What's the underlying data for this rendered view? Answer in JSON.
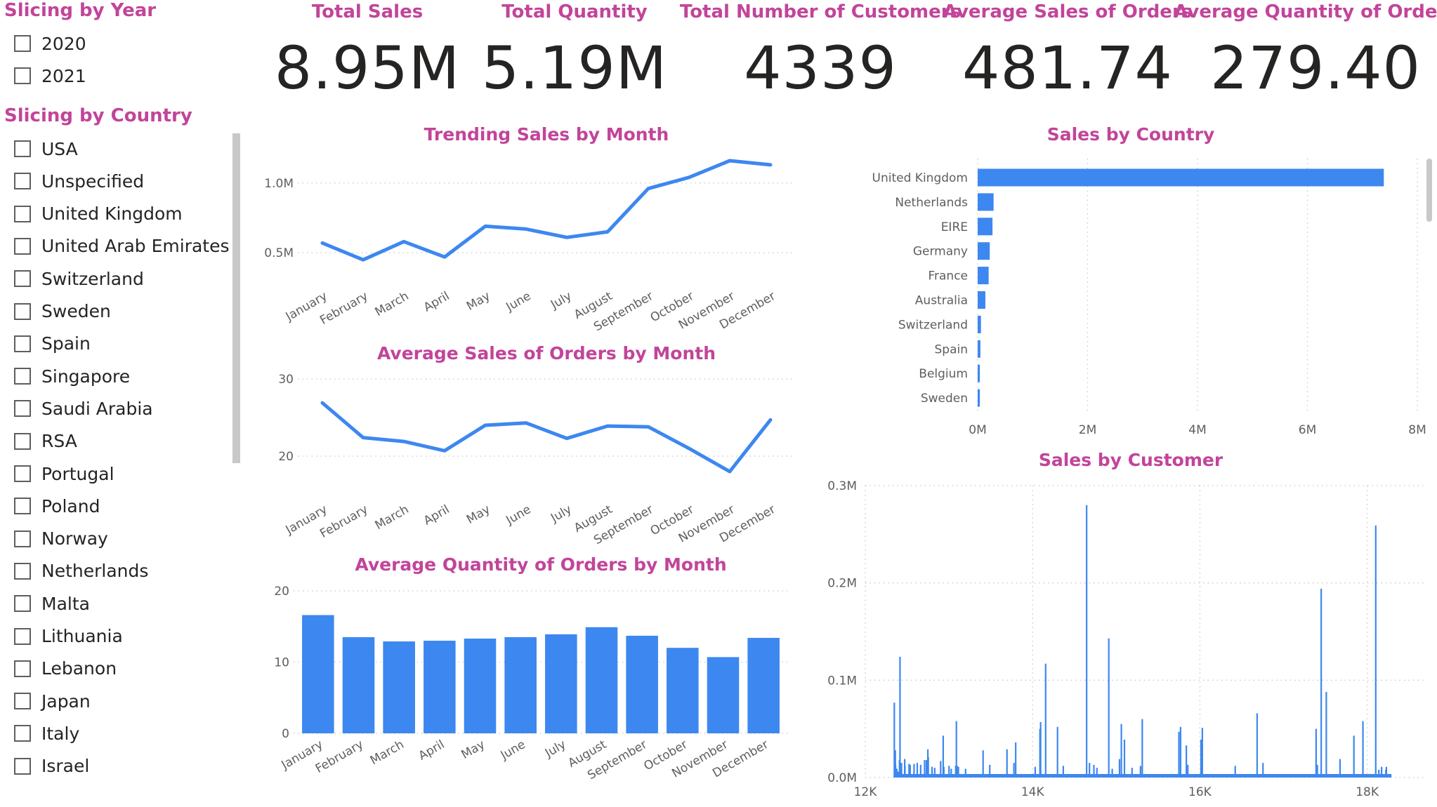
{
  "year_slicer": {
    "title": "Slicing by Year",
    "items": [
      "2020",
      "2021"
    ]
  },
  "country_slicer": {
    "title": "Slicing by Country",
    "items": [
      "USA",
      "Unspecified",
      "United Kingdom",
      "United Arab Emirates",
      "Switzerland",
      "Sweden",
      "Spain",
      "Singapore",
      "Saudi Arabia",
      "RSA",
      "Portugal",
      "Poland",
      "Norway",
      "Netherlands",
      "Malta",
      "Lithuania",
      "Lebanon",
      "Japan",
      "Italy",
      "Israel"
    ]
  },
  "kpis": [
    {
      "label": "Total Sales",
      "value": "8.95M"
    },
    {
      "label": "Total Quantity",
      "value": "5.19M"
    },
    {
      "label": "Total Number of Customers",
      "value": "4339"
    },
    {
      "label": "Average Sales of Orders",
      "value": "481.74"
    },
    {
      "label": "Average Quantity of Orders",
      "value": "279.40"
    }
  ],
  "colors": {
    "accent": "#c2449a",
    "series": "#3d87f0",
    "text": "#252423"
  },
  "chart_data": [
    {
      "id": "trend",
      "type": "line",
      "title": "Trending Sales by Month",
      "categories": [
        "January",
        "February",
        "March",
        "April",
        "May",
        "June",
        "July",
        "August",
        "September",
        "October",
        "November",
        "December"
      ],
      "values": [
        0.57,
        0.45,
        0.58,
        0.47,
        0.69,
        0.67,
        0.61,
        0.65,
        0.96,
        1.04,
        1.16,
        1.13
      ],
      "ylim": [
        0.3,
        1.2
      ],
      "yticks": [
        0.5,
        1.0
      ],
      "ytick_labels": [
        "0.5M",
        "1.0M"
      ],
      "grid": true
    },
    {
      "id": "avgsales",
      "type": "line",
      "title": "Average Sales of Orders by Month",
      "categories": [
        "January",
        "February",
        "March",
        "April",
        "May",
        "June",
        "July",
        "August",
        "September",
        "October",
        "November",
        "December"
      ],
      "values": [
        26.9,
        22.4,
        21.9,
        20.7,
        24.0,
        24.3,
        22.3,
        23.9,
        23.8,
        21.0,
        18.0,
        24.7
      ],
      "ylim": [
        17,
        30
      ],
      "yticks": [
        20,
        30
      ],
      "ytick_labels": [
        "20",
        "30"
      ],
      "grid": true
    },
    {
      "id": "avgqty",
      "type": "bar",
      "title": "Average Quantity of Orders by Month",
      "categories": [
        "January",
        "February",
        "March",
        "April",
        "May",
        "June",
        "July",
        "August",
        "September",
        "October",
        "November",
        "December"
      ],
      "values": [
        16.6,
        13.5,
        12.9,
        13.0,
        13.3,
        13.5,
        13.9,
        14.9,
        13.7,
        12.0,
        10.7,
        13.4
      ],
      "ylim": [
        0,
        20
      ],
      "yticks": [
        0,
        10,
        20
      ],
      "ytick_labels": [
        "0",
        "10",
        "20"
      ],
      "grid": true
    },
    {
      "id": "country",
      "type": "bar",
      "orientation": "horizontal",
      "title": "Sales by Country",
      "categories": [
        "United Kingdom",
        "Netherlands",
        "EIRE",
        "Germany",
        "France",
        "Australia",
        "Switzerland",
        "Spain",
        "Belgium",
        "Sweden"
      ],
      "values": [
        7.39,
        0.29,
        0.27,
        0.22,
        0.2,
        0.14,
        0.06,
        0.05,
        0.04,
        0.04
      ],
      "xlim": [
        0,
        8
      ],
      "xticks": [
        0,
        2,
        4,
        6,
        8
      ],
      "xtick_labels": [
        "0M",
        "2M",
        "4M",
        "6M",
        "8M"
      ],
      "grid": true
    },
    {
      "id": "customer",
      "type": "bar",
      "title": "Sales by Customer",
      "xlim": [
        12000,
        18700
      ],
      "xticks": [
        12000,
        14000,
        16000,
        18000
      ],
      "xtick_labels": [
        "12K",
        "14K",
        "16K",
        "18K"
      ],
      "ylim": [
        0,
        0.3
      ],
      "yticks": [
        0.0,
        0.1,
        0.2,
        0.3
      ],
      "ytick_labels": [
        "0.0M",
        "0.1M",
        "0.2M",
        "0.3M"
      ],
      "grid": true,
      "spikes": [
        [
          12347,
          0.077
        ],
        [
          12359,
          0.028
        ],
        [
          12362,
          0.013
        ],
        [
          12377,
          0.009
        ],
        [
          12395,
          0.006
        ],
        [
          12409,
          0.018
        ],
        [
          12415,
          0.124
        ],
        [
          12431,
          0.012
        ],
        [
          12433,
          0.015
        ],
        [
          12471,
          0.019
        ],
        [
          12474,
          0.012
        ],
        [
          12523,
          0.014
        ],
        [
          12536,
          0.013
        ],
        [
          12583,
          0.014
        ],
        [
          12621,
          0.015
        ],
        [
          12662,
          0.013
        ],
        [
          12709,
          0.018
        ],
        [
          12731,
          0.018
        ],
        [
          12748,
          0.029
        ],
        [
          12753,
          0.021
        ],
        [
          12798,
          0.011
        ],
        [
          12830,
          0.01
        ],
        [
          12901,
          0.017
        ],
        [
          12931,
          0.043
        ],
        [
          12939,
          0.011
        ],
        [
          13001,
          0.012
        ],
        [
          13027,
          0.009
        ],
        [
          13081,
          0.012
        ],
        [
          13089,
          0.058
        ],
        [
          13093,
          0.008
        ],
        [
          13098,
          0.012
        ],
        [
          13113,
          0.011
        ],
        [
          13199,
          0.009
        ],
        [
          13408,
          0.028
        ],
        [
          13488,
          0.013
        ],
        [
          13694,
          0.029
        ],
        [
          13777,
          0.015
        ],
        [
          13798,
          0.036
        ],
        [
          14031,
          0.011
        ],
        [
          14088,
          0.05
        ],
        [
          14096,
          0.057
        ],
        [
          14156,
          0.117
        ],
        [
          14298,
          0.052
        ],
        [
          14367,
          0.012
        ],
        [
          14646,
          0.28
        ],
        [
          14680,
          0.015
        ],
        [
          14733,
          0.013
        ],
        [
          14769,
          0.01
        ],
        [
          14911,
          0.143
        ],
        [
          14952,
          0.009
        ],
        [
          15039,
          0.019
        ],
        [
          15061,
          0.055
        ],
        [
          15098,
          0.039
        ],
        [
          15189,
          0.01
        ],
        [
          15290,
          0.012
        ],
        [
          15311,
          0.06
        ],
        [
          15749,
          0.047
        ],
        [
          15769,
          0.052
        ],
        [
          15838,
          0.033
        ],
        [
          15856,
          0.013
        ],
        [
          16013,
          0.039
        ],
        [
          16029,
          0.051
        ],
        [
          16422,
          0.012
        ],
        [
          16684,
          0.066
        ],
        [
          16754,
          0.015
        ],
        [
          17389,
          0.05
        ],
        [
          17404,
          0.013
        ],
        [
          17450,
          0.194
        ],
        [
          17511,
          0.088
        ],
        [
          17675,
          0.019
        ],
        [
          17841,
          0.043
        ],
        [
          17949,
          0.058
        ],
        [
          18102,
          0.259
        ],
        [
          18139,
          0.008
        ],
        [
          18172,
          0.011
        ],
        [
          18223,
          0.008
        ],
        [
          18229,
          0.011
        ]
      ]
    }
  ]
}
